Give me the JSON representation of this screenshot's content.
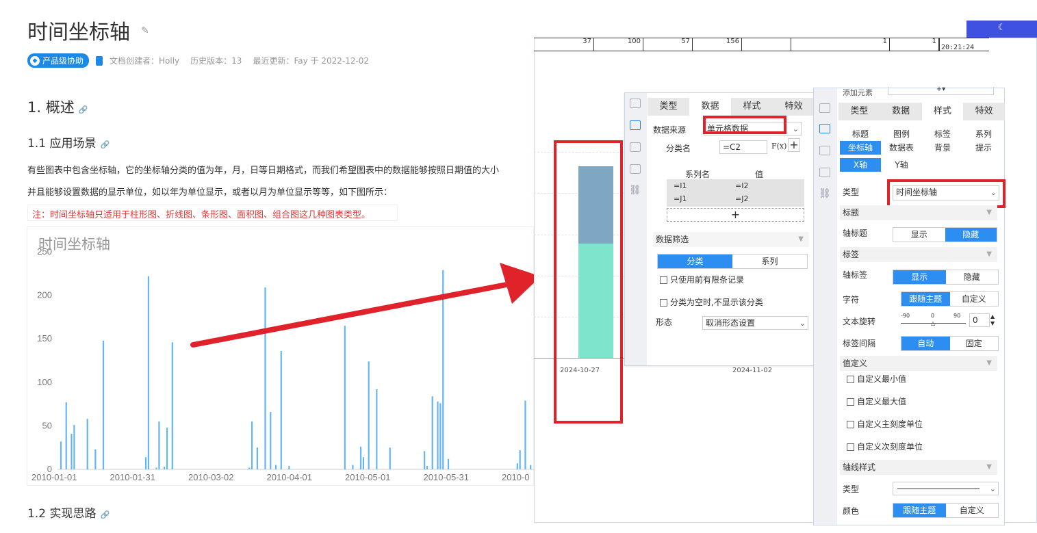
{
  "doc": {
    "title": "时间坐标轴",
    "badge": "产品级协助",
    "meta_creator": "文档创建者：Holly",
    "meta_version": "历史版本：13",
    "meta_updated": "最近更新：Fay 于 2022-12-02",
    "h1": "1. 概述",
    "h2_scene": "1.1 应用场景",
    "para1": "有些图表中包含坐标轴，它的坐标轴分类的值为年，月，日等日期格式，而我们希望图表中的数据能够按照日期值的大小",
    "para2": "并且能够设置数据的显示单位，如以年为单位显示，或者以月为单位显示等等，如下图所示：",
    "note": "注：时间坐标轴只适用于柱形图、折线图、条形图、面积图、组合图这几种图表类型。",
    "h2_impl": "1.2 实现思路"
  },
  "chart_data": {
    "type": "bar",
    "title": "时间坐标轴",
    "ylim": [
      0,
      250
    ],
    "yticks": [
      0,
      50,
      100,
      150,
      200,
      250
    ],
    "xticks": [
      "2010-01-01",
      "2010-01-31",
      "2010-03-02",
      "2010-04-01",
      "2010-05-01",
      "2010-05-31",
      "2010-0"
    ],
    "bars": [
      {
        "x": 1,
        "y": 32
      },
      {
        "x": 3,
        "y": 77
      },
      {
        "x": 5,
        "y": 41
      },
      {
        "x": 6,
        "y": 51
      },
      {
        "x": 11,
        "y": 58
      },
      {
        "x": 14,
        "y": 23
      },
      {
        "x": 17,
        "y": 148
      },
      {
        "x": 33,
        "y": 14
      },
      {
        "x": 34,
        "y": 222
      },
      {
        "x": 37,
        "y": 2
      },
      {
        "x": 38,
        "y": 55
      },
      {
        "x": 40,
        "y": 3
      },
      {
        "x": 41,
        "y": 48
      },
      {
        "x": 43,
        "y": 146
      },
      {
        "x": 72,
        "y": 2
      },
      {
        "x": 73,
        "y": 55
      },
      {
        "x": 75,
        "y": 25
      },
      {
        "x": 78,
        "y": 209
      },
      {
        "x": 80,
        "y": 66
      },
      {
        "x": 82,
        "y": 5
      },
      {
        "x": 84,
        "y": 136
      },
      {
        "x": 87,
        "y": 4
      },
      {
        "x": 108,
        "y": 165
      },
      {
        "x": 111,
        "y": 5
      },
      {
        "x": 114,
        "y": 26
      },
      {
        "x": 115,
        "y": 14
      },
      {
        "x": 117,
        "y": 124
      },
      {
        "x": 120,
        "y": 92
      },
      {
        "x": 125,
        "y": 25
      },
      {
        "x": 138,
        "y": 21
      },
      {
        "x": 139,
        "y": 4
      },
      {
        "x": 141,
        "y": 84
      },
      {
        "x": 143,
        "y": 78
      },
      {
        "x": 144,
        "y": 76
      },
      {
        "x": 145,
        "y": 229
      },
      {
        "x": 147,
        "y": 12
      },
      {
        "x": 173,
        "y": 7
      },
      {
        "x": 174,
        "y": 22
      },
      {
        "x": 176,
        "y": 79
      },
      {
        "x": 178,
        "y": 5
      },
      {
        "x": 181,
        "y": 22
      },
      {
        "x": 184,
        "y": 147
      },
      {
        "x": 186,
        "y": 2
      }
    ],
    "x_range": [
      0,
      195
    ],
    "color": "#64b5f6"
  },
  "preview": {
    "strip_values": [
      "37",
      "100",
      "57",
      "156",
      "",
      "1",
      "1"
    ],
    "time": "20:21:24",
    "date1": "2024-10-27",
    "date2": "2024-11-02",
    "bar_colors": [
      "#7ea7c3",
      "#7fe4cc"
    ]
  },
  "dlg1": {
    "tabs": [
      "类型",
      "数据",
      "样式",
      "特效"
    ],
    "source_label": "数据来源",
    "source_value": "单元格数据",
    "cat_label": "分类名",
    "cat_value": "=C2",
    "fx": "F(x)",
    "plus": "+",
    "col_series": "系列名",
    "col_value": "值",
    "rows": [
      [
        "=I1",
        "=I2"
      ],
      [
        "=J1",
        "=J2"
      ]
    ],
    "filter_label": "数据筛选",
    "seg_cat": "分类",
    "seg_series": "系列",
    "chk1": "只使用前有限条记录",
    "chk2": "分类为空时,不显示该分类",
    "shape_label": "形态",
    "shape_value": "取消形态设置"
  },
  "dlg2": {
    "add_elem": "添加元素",
    "tabs": [
      "类型",
      "数据",
      "样式",
      "特效"
    ],
    "subtabs": [
      "标题",
      "图例",
      "标签",
      "系列",
      "坐标轴",
      "数据表",
      "背景",
      "提示"
    ],
    "axis_tabs": [
      "X轴",
      "Y轴"
    ],
    "type_label": "类型",
    "type_value": "时间坐标轴",
    "sec_title": "标题",
    "axis_title_label": "轴标题",
    "show": "显示",
    "hide": "隐藏",
    "sec_label": "标签",
    "axis_label_label": "轴标签",
    "font_label": "字符",
    "follow_theme": "跟随主题",
    "custom": "自定义",
    "rotate_label": "文本旋转",
    "rotate_min": "-90",
    "rotate_mid": "0",
    "rotate_max": "90",
    "rotate_value": "0",
    "interval_label": "标签间隔",
    "auto": "自动",
    "fixed": "固定",
    "sec_value": "值定义",
    "chk_min": "自定义最小值",
    "chk_max": "自定义最大值",
    "chk_major": "自定义主刻度单位",
    "chk_minor": "自定义次刻度单位",
    "sec_line": "轴线样式",
    "line_type": "类型",
    "line_color": "颜色"
  }
}
